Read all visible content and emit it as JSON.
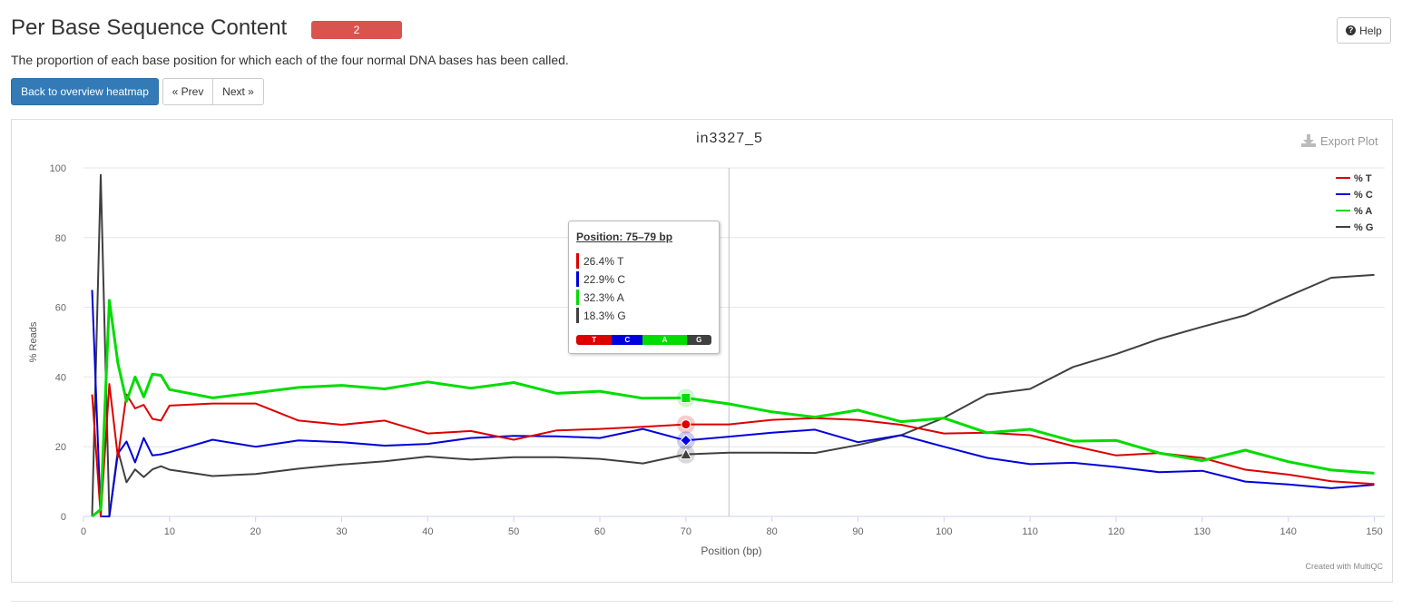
{
  "header": {
    "title": "Per Base Sequence Content",
    "badge_count": "2",
    "help_label": "Help"
  },
  "description": "The proportion of each base position for which each of the four normal DNA bases has been called.",
  "nav": {
    "back_label": "Back to overview heatmap",
    "prev_label": "« Prev",
    "next_label": "Next »"
  },
  "plot": {
    "export_label": "Export Plot",
    "credit": "Created with MultiQC"
  },
  "tooltip": {
    "title": "Position: 75–79 bp",
    "rows": [
      "26.4% T",
      "22.9% C",
      "32.3% A",
      "18.3% G"
    ],
    "bar": [
      {
        "label": "T",
        "pct": 26.4,
        "color": "#dc0000"
      },
      {
        "label": "C",
        "pct": 22.9,
        "color": "#0000dc"
      },
      {
        "label": "A",
        "pct": 32.3,
        "color": "#00dc00"
      },
      {
        "label": "G",
        "pct": 18.3,
        "color": "#404040"
      }
    ]
  },
  "chart_data": {
    "type": "line",
    "title": "in3327_5",
    "xlabel": "Position (bp)",
    "ylabel": "% Reads",
    "xlim": [
      0,
      151
    ],
    "ylim": [
      0,
      100
    ],
    "xticks": [
      0,
      10,
      20,
      30,
      40,
      50,
      60,
      70,
      80,
      90,
      100,
      110,
      120,
      130,
      140,
      150
    ],
    "yticks": [
      0,
      20,
      40,
      60,
      80,
      100
    ],
    "grid": true,
    "legend_position": "top-right",
    "crosshair_x": 75,
    "highlight_index": 21,
    "x": [
      1,
      2,
      3,
      4,
      5,
      6,
      7,
      8,
      9,
      10,
      15,
      20,
      25,
      30,
      35,
      40,
      45,
      50,
      55,
      60,
      65,
      70,
      75,
      80,
      85,
      90,
      95,
      100,
      105,
      110,
      115,
      120,
      125,
      130,
      135,
      140,
      145,
      150
    ],
    "series": [
      {
        "name": "% T",
        "color": "#dc0000",
        "marker": "circle",
        "values": [
          35,
          0,
          38,
          17,
          35,
          31,
          32,
          28,
          27.5,
          31.8,
          32.4,
          32.4,
          27.5,
          26.3,
          27.5,
          23.8,
          24.5,
          22,
          24.7,
          25.1,
          25.7,
          26.4,
          26.4,
          27.7,
          28.2,
          27.7,
          26.3,
          23.8,
          24,
          23.3,
          20.2,
          17.5,
          18.2,
          16.8,
          13.4,
          12,
          10.1,
          9.3
        ]
      },
      {
        "name": "% C",
        "color": "#0000dc",
        "marker": "diamond",
        "values": [
          65,
          0,
          0,
          18,
          21.5,
          15.5,
          22.5,
          17.5,
          17.8,
          18.4,
          22,
          20,
          21.8,
          21.3,
          20.3,
          20.8,
          22.5,
          23.1,
          23,
          22.5,
          25.1,
          21.8,
          22.9,
          24,
          24.9,
          21.3,
          23.3,
          20,
          16.8,
          15,
          15.4,
          14.2,
          12.7,
          13.1,
          10,
          9.2,
          8.1,
          9.1
        ]
      },
      {
        "name": "% A",
        "color": "#00dc00",
        "marker": "square",
        "values": [
          0,
          2,
          62,
          44,
          33,
          40,
          34.3,
          40.8,
          40.5,
          36.4,
          34,
          35.5,
          37,
          37.6,
          36.6,
          38.6,
          36.8,
          38.4,
          35.3,
          35.9,
          33.9,
          34,
          32.3,
          30,
          28.5,
          30.5,
          27.2,
          28.2,
          24,
          25,
          21.6,
          21.8,
          18.2,
          16,
          19,
          15.7,
          13.3,
          12.4
        ]
      },
      {
        "name": "% G",
        "color": "#404040",
        "marker": "triangle",
        "values": [
          0,
          98,
          0,
          19,
          9.8,
          13.5,
          11.3,
          13.5,
          14.4,
          13.4,
          11.6,
          12.2,
          13.7,
          14.9,
          15.8,
          17.2,
          16.3,
          17,
          17,
          16.5,
          15.2,
          17.8,
          18.3,
          18.3,
          18.2,
          20.5,
          23.3,
          28.3,
          35,
          36.6,
          42.9,
          46.6,
          50.9,
          54.4,
          57.7,
          63.2,
          68.5,
          69.3
        ]
      }
    ]
  }
}
